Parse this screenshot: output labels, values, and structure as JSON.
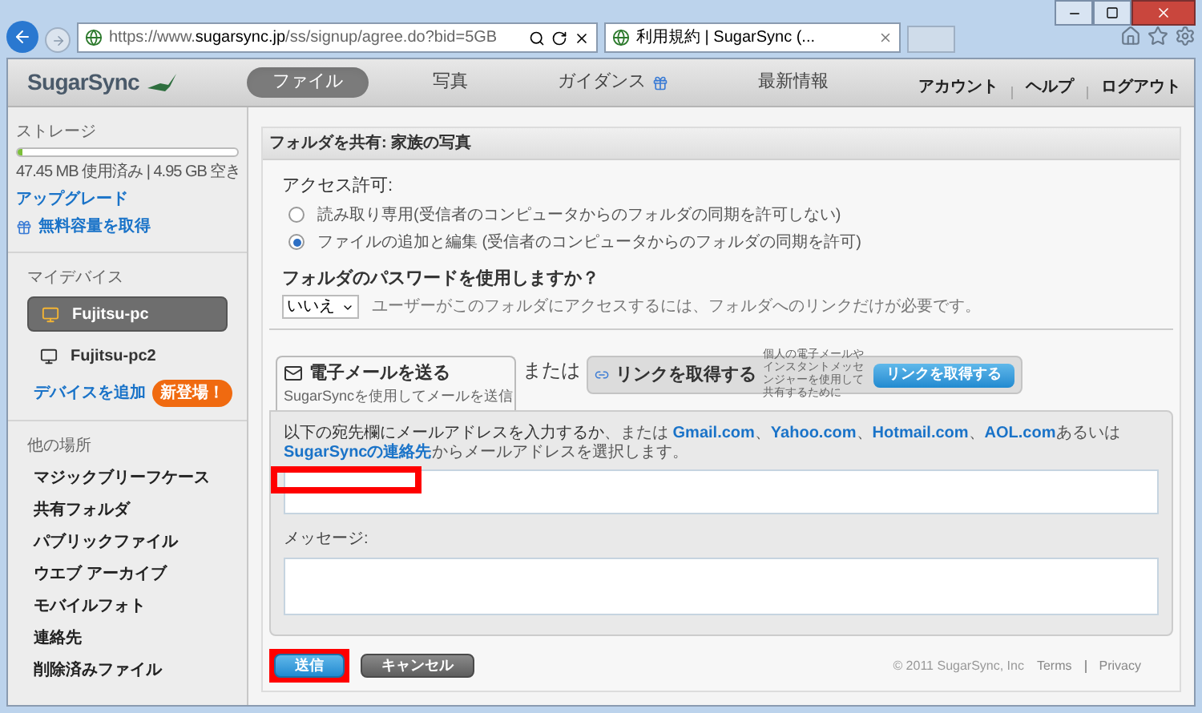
{
  "browser": {
    "url": "https://www.**sugarsync.jp**/ss/signup/agree.do?bid=5GB",
    "tab_title": "利用規約 | SugarSync (..."
  },
  "header": {
    "logo": "SugarSync",
    "nav": [
      {
        "label": "ファイル",
        "selected": true
      },
      {
        "label": "写真",
        "selected": false
      },
      {
        "label": "ガイダンス",
        "selected": false,
        "gift": true
      },
      {
        "label": "最新情報",
        "selected": false
      }
    ],
    "user_links": [
      "アカウント",
      "ヘルプ",
      "ログアウト"
    ]
  },
  "sidebar": {
    "storage": {
      "title": "ストレージ",
      "level": 0.02,
      "usage": "47.45 MB 使用済み | 4.95 GB 空き",
      "upgrade": "アップグレード",
      "free_space": "無料容量を取得"
    },
    "devices": {
      "title": "マイデバイス",
      "items": [
        {
          "label": "Fujitsu-pc",
          "selected": true
        },
        {
          "label": "Fujitsu-pc2",
          "selected": false
        }
      ],
      "add": "デバイスを追加",
      "new_badge": "新登場！"
    },
    "other": {
      "title": "他の場所",
      "items": [
        "マジックブリーフケース",
        "共有フォルダ",
        "パブリックファイル",
        "ウエブ アーカイブ",
        "モバイルフォト",
        "連絡先",
        "削除済みファイル"
      ]
    }
  },
  "panel": {
    "title": "フォルダを共有: 家族の写真",
    "access": {
      "label": "アクセス許可:",
      "options": [
        {
          "label": "読み取り専用(受信者のコンピュータからのフォルダの同期を許可しない)",
          "selected": false
        },
        {
          "label": "ファイルの追加と編集 (受信者のコンピュータからのフォルダの同期を許可)",
          "selected": true
        }
      ]
    },
    "password": {
      "label": "フォルダのパスワードを使用しますか？",
      "select": "いいえ",
      "hint": "ユーザーがこのフォルダにアクセスするには、フォルダへのリンクだけが必要です。"
    },
    "email_tab": {
      "title": "電子メールを送る",
      "subtitle": "SugarSyncを使用してメールを送信",
      "selected": true
    },
    "or": "または",
    "link_tab": {
      "title": "リンクを取得する",
      "description": "個人の電子メールやインスタントメッセンジャーを使用して共有するために",
      "button": "リンクを取得する",
      "selected": false
    },
    "instructions": [
      {
        "text": "以下の宛先欄にメールアドレスを入力するか",
        "kind": "lead"
      },
      {
        "text": "、または ",
        "kind": "plain"
      },
      {
        "text": "Gmail.com",
        "kind": "link"
      },
      {
        "text": "、",
        "kind": "plain"
      },
      {
        "text": "Yahoo.com",
        "kind": "link"
      },
      {
        "text": "、",
        "kind": "plain"
      },
      {
        "text": "Hotmail.com",
        "kind": "link"
      },
      {
        "text": "、",
        "kind": "plain"
      },
      {
        "text": "AOL.com",
        "kind": "link"
      },
      {
        "text": "あるいは ",
        "kind": "plain"
      },
      {
        "text": "SugarSyncの連絡先",
        "kind": "link"
      },
      {
        "text": "からメールアドレスを選択します。",
        "kind": "plain"
      }
    ],
    "message_label": "メッセージ:",
    "buttons": [
      {
        "label": "送信",
        "kind": "primary",
        "highlighted": true
      },
      {
        "label": "キャンセル",
        "kind": "secondary",
        "highlighted": false
      }
    ],
    "footer": {
      "copyright": "© 2011 SugarSync, Inc",
      "terms": "Terms",
      "privacy": "Privacy"
    }
  }
}
